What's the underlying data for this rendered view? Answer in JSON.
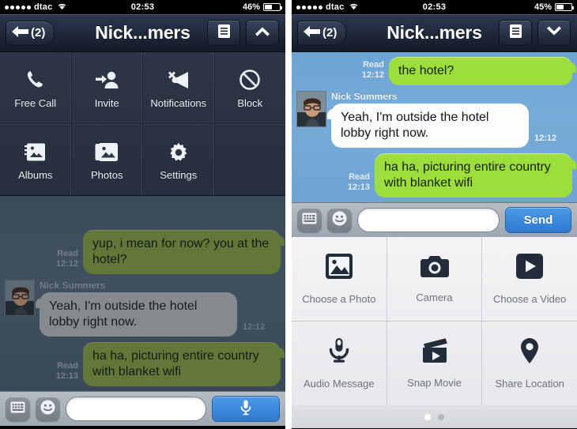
{
  "left": {
    "status": {
      "carrier": "dtac",
      "signal_dots": 5,
      "wifi_icon": "wifi-icon",
      "time": "02:53",
      "battery_text": "46%",
      "battery_level": 46
    },
    "nav": {
      "back_label": "(2)",
      "back_icon": "back-arrow-icon",
      "title": "Nick...mers",
      "menu_icon": "list-icon",
      "toggle_icon": "chevron-up-icon"
    },
    "menu": {
      "items": [
        {
          "label": "Free Call",
          "icon": "phone-icon"
        },
        {
          "label": "Invite",
          "icon": "add-person-icon"
        },
        {
          "label": "Notifications",
          "icon": "megaphone-mute-icon"
        },
        {
          "label": "Block",
          "icon": "block-icon"
        },
        {
          "label": "Albums",
          "icon": "albums-icon"
        },
        {
          "label": "Photos",
          "icon": "photos-icon"
        },
        {
          "label": "Settings",
          "icon": "gear-icon"
        }
      ]
    },
    "chat": {
      "messages": [
        {
          "side": "out",
          "text": "yup, i mean for now? you at the hotel?",
          "status": "Read",
          "time": "12:12"
        },
        {
          "side": "in",
          "sender": "Nick Summers",
          "text": "Yeah, I'm outside the hotel lobby right now.",
          "time": "12:12",
          "avatar": "contact-avatar"
        },
        {
          "side": "out",
          "text": "ha ha, picturing entire country with blanket wifi",
          "status": "Read",
          "time": "12:13"
        }
      ]
    },
    "input": {
      "keyboard_icon": "keyboard-icon",
      "sticker_icon": "smiley-icon",
      "placeholder": "",
      "value": "",
      "action_icon": "microphone-icon"
    }
  },
  "right": {
    "status": {
      "carrier": "dtac",
      "signal_dots": 5,
      "wifi_icon": "wifi-icon",
      "time": "02:53",
      "battery_text": "45%",
      "battery_level": 45
    },
    "nav": {
      "back_label": "(2)",
      "back_icon": "back-arrow-icon",
      "title": "Nick...mers",
      "menu_icon": "list-icon",
      "toggle_icon": "chevron-down-icon"
    },
    "chat": {
      "messages": [
        {
          "side": "out",
          "text": "the hotel?",
          "status": "Read",
          "time": "12:12"
        },
        {
          "side": "in",
          "sender": "Nick Summers",
          "text": "Yeah, I'm outside the hotel lobby right now.",
          "time": "12:12",
          "avatar": "contact-avatar"
        },
        {
          "side": "out",
          "text": "ha ha, picturing entire country with blanket wifi",
          "status": "Read",
          "time": "12:13"
        }
      ]
    },
    "input": {
      "keyboard_icon": "keyboard-icon",
      "sticker_icon": "smiley-icon",
      "placeholder": "",
      "value": "",
      "send_label": "Send"
    },
    "attachments": {
      "items": [
        {
          "label": "Choose a Photo",
          "icon": "photo-icon"
        },
        {
          "label": "Camera",
          "icon": "camera-icon"
        },
        {
          "label": "Choose a Video",
          "icon": "video-play-icon"
        },
        {
          "label": "Audio Message",
          "icon": "microphone-icon"
        },
        {
          "label": "Snap Movie",
          "icon": "clapperboard-icon"
        },
        {
          "label": "Share Location",
          "icon": "location-pin-icon"
        }
      ],
      "pages": 2,
      "current_page": 1
    }
  },
  "colors": {
    "navbar_dark": "#1b2332",
    "menu_panel": "#2c3646",
    "bubble_green_bright": "#9ede3c",
    "bubble_green_dim": "#86a343",
    "bubble_white": "#fdfdfd",
    "bubble_grey_dim": "#b8bcbd",
    "chat_bg_blue": "#6ba4d4",
    "chat_bg_dim": "#56697a",
    "send_blue": "#3b88de"
  }
}
